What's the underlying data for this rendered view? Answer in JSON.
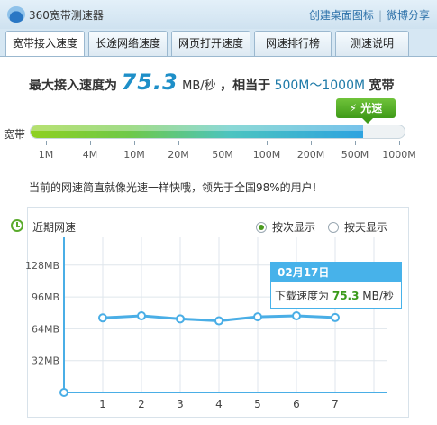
{
  "window": {
    "title": "360宽带测速器",
    "links": [
      "创建桌面图标",
      "微博分享"
    ],
    "close_glyph": "✕"
  },
  "tabs": [
    {
      "label": "宽带接入速度",
      "active": true
    },
    {
      "label": "长途网络速度",
      "active": false
    },
    {
      "label": "网页打开速度",
      "active": false
    },
    {
      "label": "网速排行榜",
      "active": false
    },
    {
      "label": "测速说明",
      "active": false
    }
  ],
  "result": {
    "prefix": "最大接入速度为",
    "speed": "75.3",
    "unit": "MB/秒",
    "middle": "，相当于",
    "range": "500M～1000M",
    "suffix": "宽带"
  },
  "lightning": {
    "label": "光速",
    "glyph": "⚡",
    "color": "#4ca421"
  },
  "bandwidth_bar": {
    "label": "宽带",
    "ticks": [
      "1M",
      "4M",
      "10M",
      "20M",
      "50M",
      "100M",
      "200M",
      "500M",
      "1000M"
    ],
    "fill_fraction": 0.89
  },
  "description": "当前的网速简直就像光速一样快哦，领先于全国98%的用户!",
  "history": {
    "title": "近期网速",
    "options": [
      {
        "label": "按次显示",
        "checked": true
      },
      {
        "label": "按天显示",
        "checked": false
      }
    ],
    "tooltip": {
      "date": "02月17日",
      "label": "下载速度为",
      "value": "75.3",
      "unit": "MB/秒"
    }
  },
  "chart_data": {
    "type": "line",
    "x": [
      0,
      1,
      2,
      3,
      4,
      5,
      6,
      7
    ],
    "values": [
      0,
      75,
      77,
      74,
      72,
      76,
      77,
      75.3
    ],
    "y_ticks": [
      "32MB",
      "64MB",
      "96MB",
      "128MB"
    ],
    "y_tick_values": [
      32,
      64,
      96,
      128
    ],
    "x_tick_labels": [
      "1",
      "2",
      "3",
      "4",
      "5",
      "6",
      "7"
    ],
    "ylim": [
      0,
      145
    ],
    "grid": true,
    "line_color": "#4aaee6"
  }
}
